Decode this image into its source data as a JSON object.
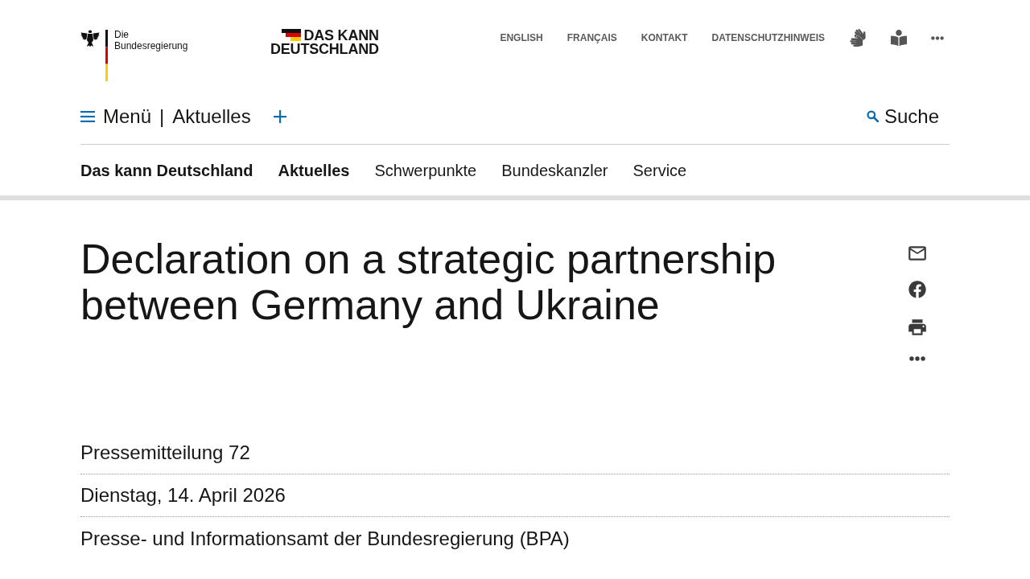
{
  "header": {
    "government_logo": {
      "line_1": "Die",
      "line_2": "Bundesregierung"
    },
    "campaign_logo": {
      "line_1": "DAS KANN",
      "line_2": "DEUTSCHLAND"
    },
    "service_links": [
      "ENGLISH",
      "FRANÇAIS",
      "KONTAKT",
      "DATENSCHUTZHINWEIS"
    ],
    "service_icons": [
      {
        "kind": "sign-language"
      },
      {
        "kind": "easy-read"
      },
      {
        "kind": "more"
      }
    ]
  },
  "main_nav": {
    "menu_label": "Menü",
    "separator": "|",
    "current_section": "Aktuelles",
    "search_label": "Suche"
  },
  "section_nav": {
    "title": "Das kann Deutschland",
    "items": [
      {
        "label": "Aktuelles",
        "selected": true
      },
      {
        "label": "Schwerpunkte",
        "selected": false
      },
      {
        "label": "Bundeskanzler",
        "selected": false
      },
      {
        "label": "Service",
        "selected": false
      }
    ]
  },
  "article": {
    "title": "Declaration on a strategic partnership between Germany and Ukraine",
    "share_actions": [
      {
        "kind": "email"
      },
      {
        "kind": "facebook"
      },
      {
        "kind": "print"
      },
      {
        "kind": "more"
      }
    ],
    "meta": [
      "Pressemitteilung 72",
      "Dienstag, 14. April 2026",
      "Presse- und Informationsamt der Bundesregierung (BPA)"
    ]
  }
}
